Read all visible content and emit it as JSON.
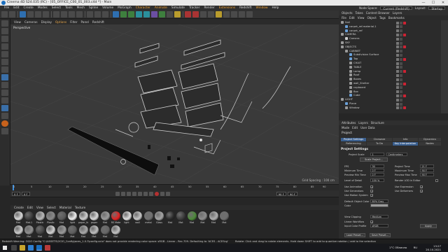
{
  "window": {
    "title": "Cinema 4D S24.035 (RC) - [05_OFFICE_C00_01_003.c4d *] - Main",
    "controls": [
      "—",
      "☐",
      "✕"
    ]
  },
  "menubar": {
    "items": [
      "File",
      "Edit",
      "Create",
      "Modes",
      "Select",
      "Tools",
      "Mesh",
      "Spline",
      "Volume",
      "MoGraph",
      "Character",
      "Animate",
      "Simulate",
      "Tracker",
      "Render",
      "Extensions",
      "Redshift",
      "Window",
      "Help"
    ],
    "highlighted": [
      "Character",
      "Animate",
      "Extensions",
      "Window"
    ],
    "node_space_label": "Node Space:",
    "node_space_value": "Current (Redshift)",
    "layout_label": "Layout:",
    "layout_value": "Startup"
  },
  "viewport": {
    "menu": [
      "View",
      "Cameras",
      "Display",
      "Options",
      "Filter",
      "Panel",
      "Redshift"
    ],
    "active_menu": "Options",
    "label": "Perspective",
    "grid_label": "Grid Spacing : 100 cm"
  },
  "timeline": {
    "ticks": [
      "0",
      "5",
      "10",
      "15",
      "20",
      "25",
      "30",
      "35",
      "40",
      "45",
      "50",
      "55",
      "60",
      "65",
      "70",
      "75",
      "80",
      "85",
      "90"
    ],
    "end_frame": "0 F",
    "start_field": "0 F",
    "end_field": "90 F",
    "end_field2": "90 F"
  },
  "material_manager": {
    "menu": [
      "Create",
      "Edit",
      "View",
      "Select",
      "Material",
      "Texture"
    ],
    "materials": [
      {
        "name": "Mat",
        "color": "#d8d8d8"
      },
      {
        "name": "Mat.1",
        "color": "#3b3b3b"
      },
      {
        "name": "Plastic",
        "color": "#b9b9b9"
      },
      {
        "name": "Plastic",
        "color": "#8a8a8a"
      },
      {
        "name": "Mat",
        "color": "#5a5a5a"
      },
      {
        "name": "light",
        "color": "#efefef"
      },
      {
        "name": "paper_fo",
        "color": "#cfcfcf"
      },
      {
        "name": "paper",
        "color": "#d9d9d9"
      },
      {
        "name": "Mat",
        "color": "#9c9c9c"
      },
      {
        "name": "RS Mate",
        "color": "#e02222"
      },
      {
        "name": "light",
        "color": "#dedede"
      },
      {
        "name": "wall",
        "color": "#c6c6c6"
      },
      {
        "name": "metal",
        "color": "#707070"
      },
      {
        "name": "Glass",
        "color": "#a4a4a4"
      },
      {
        "name": "Mat",
        "color": "#2a2a2a"
      },
      {
        "name": "Mat",
        "color": "#3c3c3c"
      },
      {
        "name": "Mat",
        "color": "#4d8a3a"
      },
      {
        "name": "Mat",
        "color": "#8c8c8c"
      },
      {
        "name": "Mat",
        "color": "#b0b0b0"
      },
      {
        "name": "Mat",
        "color": "#6f6f6f"
      },
      {
        "name": "Mat",
        "color": "#cccccc"
      },
      {
        "name": "Mat",
        "color": "#8f8f8f"
      },
      {
        "name": "Mat",
        "color": "#444444"
      },
      {
        "name": "Mat",
        "color": "#d0d0d0"
      },
      {
        "name": "Mat",
        "color": "#9a9a9a"
      },
      {
        "name": "Mat",
        "color": "#5e5e5e"
      },
      {
        "name": "Mat",
        "color": "#a8a8a8"
      },
      {
        "name": "Mat",
        "color": "#bdbdbd"
      },
      {
        "name": "Mat",
        "color": "#666666"
      },
      {
        "name": "Mat",
        "color": "#c2c2c2"
      }
    ]
  },
  "statusbar": {
    "text": "Redshift Warning: OCIO Config \"C:\\ASSETS\\OCIO_Config\\aces_1.0.3\\config.ocio\" does not provide rendering color space: sRGB - Linear - Rec.709. Defaulting to 'ACES - ACEScg'",
    "hint": "Rotate: Click and drag to rotate elements. Hold down SHIFT to add to quantize rotation / add to the selection"
  },
  "taskbar": {
    "tray_text": "RU",
    "weather": "1°C Облачно",
    "time": "13:27",
    "date": "20.10.2021"
  },
  "right_tabs": [
    "Objects",
    "Takes",
    "Content Browser",
    "Layers"
  ],
  "object_manager": {
    "menu": [
      "File",
      "Edit",
      "View",
      "Object",
      "Tags",
      "Bookmarks"
    ],
    "objects": [
      {
        "name": "Null",
        "indent": 0,
        "color": "#9a9a9a"
      },
      {
        "name": "carpet_ref.material.1",
        "indent": 1,
        "color": "#6aa0d8"
      },
      {
        "name": "carpet_ref",
        "indent": 1,
        "color": "#6aa0d8"
      },
      {
        "name": "CAMERA",
        "indent": 0,
        "color": "#9a9a9a"
      },
      {
        "name": "Camera",
        "indent": 1,
        "color": "#cfcfcf"
      },
      {
        "name": "SKY",
        "indent": 0,
        "color": "#9a9a9a"
      },
      {
        "name": "OBJECTS",
        "indent": 0,
        "color": "#9a9a9a"
      },
      {
        "name": "CABINET",
        "indent": 1,
        "color": "#9a9a9a"
      },
      {
        "name": "Subdivision Surface",
        "indent": 2,
        "color": "#6aa0d8"
      },
      {
        "name": "Top",
        "indent": 2,
        "color": "#6aa0d8"
      },
      {
        "name": "CHAIT",
        "indent": 2,
        "color": "#9a9a9a"
      },
      {
        "name": "TABLE",
        "indent": 2,
        "color": "#9a9a9a"
      },
      {
        "name": "Lamp",
        "indent": 2,
        "color": "#9a9a9a"
      },
      {
        "name": "Roof",
        "indent": 2,
        "color": "#9a9a9a"
      },
      {
        "name": "Boxes",
        "indent": 2,
        "color": "#9a9a9a"
      },
      {
        "name": "wall_Shelter",
        "indent": 2,
        "color": "#9a9a9a"
      },
      {
        "name": "cupboard",
        "indent": 2,
        "color": "#9a9a9a"
      },
      {
        "name": "Box",
        "indent": 2,
        "color": "#9a9a9a"
      },
      {
        "name": "Cube",
        "indent": 2,
        "color": "#6aa0d8"
      },
      {
        "name": "LIGHT",
        "indent": 0,
        "color": "#9a9a9a"
      },
      {
        "name": "Plane",
        "indent": 1,
        "color": "#6aa0d8"
      },
      {
        "name": "Window",
        "indent": 1,
        "color": "#9a9a9a"
      }
    ]
  },
  "attribute_manager": {
    "tabs": [
      "Attributes",
      "Layers",
      "Structure"
    ],
    "menu": [
      "Mode",
      "Edit",
      "User Data"
    ],
    "title": "Project",
    "subtabs": [
      "Project Settings",
      "Cineware",
      "Info",
      "Dynamics",
      "Referencing",
      "To Do",
      "Key Interpolation",
      "Nodes"
    ],
    "active_subtab": "Project Settings",
    "section_title": "Project Settings",
    "props": {
      "project_scale_label": "Project Scale",
      "project_scale_value": "1",
      "project_scale_unit": "Centimeters",
      "scale_project_button": "Scale Project...",
      "fps_label": "FPS",
      "fps_value": "30",
      "project_time_label": "Project Time",
      "project_time_value": "21 F",
      "min_time_label": "Minimum Time",
      "min_time_value": "0 F",
      "max_time_label": "Maximum Time",
      "max_time_value": "90 F",
      "preview_min_label": "Preview Min Time",
      "preview_min_value": "0 F",
      "preview_max_label": "Preview Max Time",
      "preview_max_value": "90 F",
      "lod_label": "Level of Detail",
      "lod_value": "100 %",
      "render_lod_label": "Render LOD in Editor",
      "use_animation_label": "Use Animation",
      "use_expression_label": "Use Expression",
      "use_generators_label": "Use Generators",
      "use_deformers_label": "Use Deformers",
      "use_motion_label": "Use Motion System",
      "default_obj_color_label": "Default Object Color",
      "default_obj_color_value": "80% Gray",
      "color_label": "Color",
      "view_clipping_label": "View Clipping",
      "view_clipping_value": "Medium",
      "linear_workflow_label": "Linear Workflow",
      "input_color_label": "Input Color Profile",
      "input_color_value": "sRGB",
      "apply_button": "Apply",
      "load_preset_button": "Load Preset...",
      "save_preset_button": "Save Preset..."
    }
  }
}
